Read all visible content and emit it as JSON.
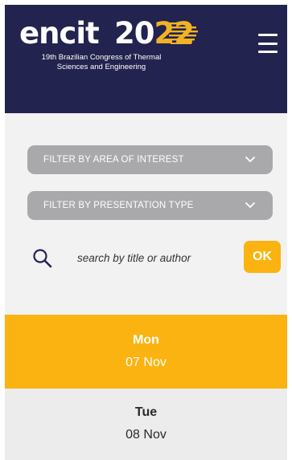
{
  "header": {
    "logo_word": "encit",
    "logo_year_prefix": "20",
    "logo_year_suffix": "22",
    "subtitle_line1": "19th Brazilian Congress of Thermal",
    "subtitle_line2": "Sciences and Engineering",
    "menu_icon": "hamburger-menu-icon"
  },
  "filters": {
    "area": {
      "label": "FILTER BY AREA OF INTEREST",
      "icon": "chevron-down-icon"
    },
    "presentation": {
      "label": "FILTER BY PRESENTATION TYPE",
      "icon": "chevron-down-icon"
    }
  },
  "search": {
    "icon": "search-icon",
    "placeholder": "search by title or author",
    "button_label": "OK"
  },
  "days": [
    {
      "name": "Mon",
      "date": "07 Nov",
      "selected": true
    },
    {
      "name": "Tue",
      "date": "08 Nov",
      "selected": false
    }
  ],
  "colors": {
    "header_bg": "#23234f",
    "accent": "#fbb311",
    "select_bg": "#a9a9ab",
    "page_bg": "#f2f2f2"
  }
}
